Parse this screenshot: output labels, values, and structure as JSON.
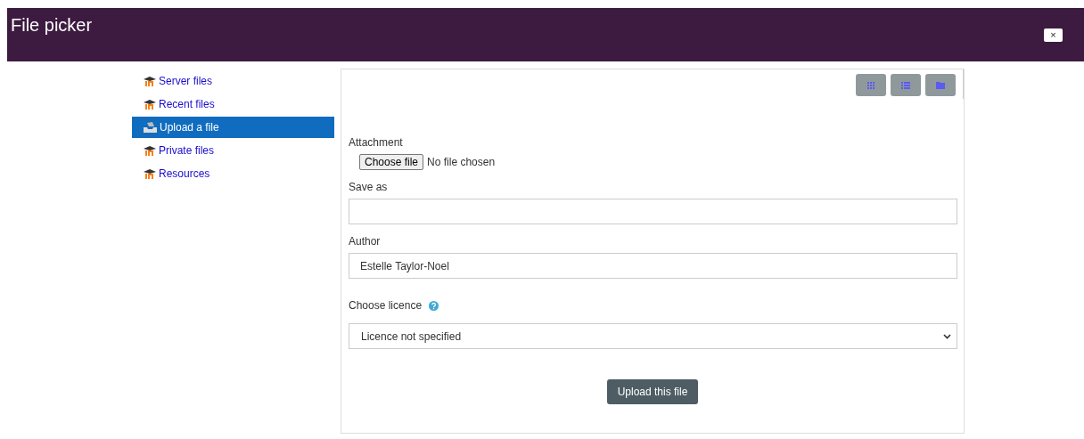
{
  "window": {
    "title": "File picker",
    "close": "×"
  },
  "sidebar": {
    "items": [
      {
        "label": "Server files",
        "kind": "repository",
        "selected": false
      },
      {
        "label": "Recent files",
        "kind": "repository",
        "selected": false
      },
      {
        "label": "Upload a file",
        "kind": "upload",
        "selected": true
      },
      {
        "label": "Private files",
        "kind": "repository",
        "selected": false
      },
      {
        "label": "Resources",
        "kind": "repository",
        "selected": false
      }
    ]
  },
  "toolbar": {
    "buttons": [
      {
        "kind": "icons"
      },
      {
        "kind": "list"
      },
      {
        "kind": "tree"
      }
    ]
  },
  "form": {
    "attachment": {
      "label": "Attachment",
      "button": "Choose file",
      "status": "No file chosen"
    },
    "save_as": {
      "label": "Save as"
    },
    "author": {
      "label": "Author",
      "value": "Estelle Taylor-Noel"
    },
    "licence": {
      "label": "Choose licence",
      "value": "Licence not specified"
    },
    "submit": "Upload this file"
  }
}
